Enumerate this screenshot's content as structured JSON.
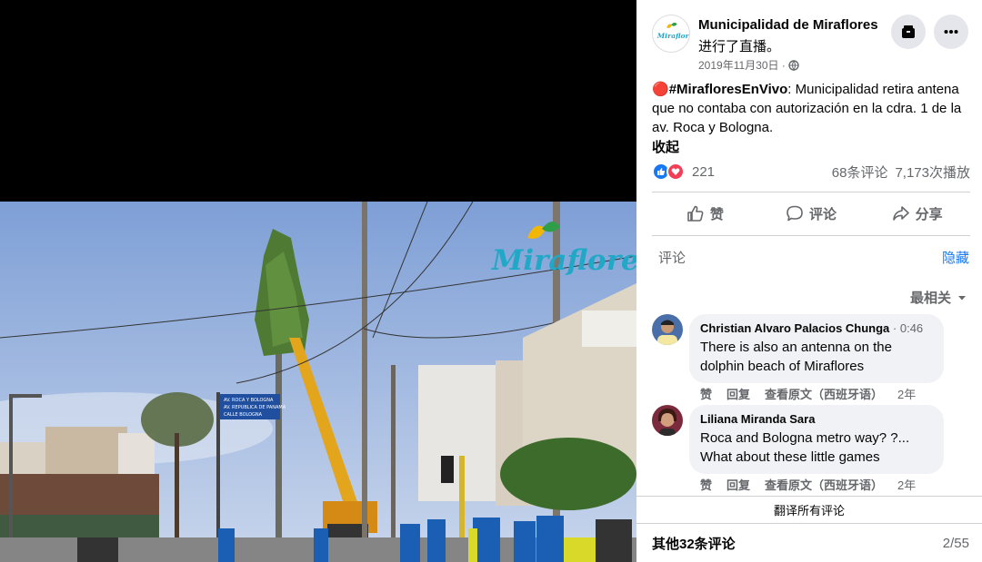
{
  "video": {
    "logo_text": "Miraflores",
    "sign_lines": [
      "AV. ROCA Y BOLOGNA",
      "AV. REPUBLICA DE PANAMA",
      "CALLE BOLOGNA"
    ]
  },
  "post": {
    "page_name": "Municipalidad de Miraflores",
    "avatar_text": "Miraflores",
    "status": "进行了直播。",
    "date": "2019年11月30日 ·",
    "live_dot": "🔴",
    "hashtag": "#MirafloresEnVivo",
    "text": ": Municipalidad retira antena que no contaba con autorización en la cdra. 1 de la av. Roca y Bologna.",
    "collapse_label": "收起",
    "reaction_count": "221",
    "comment_count": "68条评论",
    "view_count": "7,173次播放"
  },
  "actions": {
    "like": "赞",
    "comment": "评论",
    "share": "分享"
  },
  "comments_section": {
    "header": "评论",
    "hide_label": "隐藏",
    "sort_label": "最相关",
    "translate_all": "翻译所有评论",
    "more_comments": "其他32条评论",
    "page_count": "2/55"
  },
  "comments": [
    {
      "author": "Christian Alvaro Palacios Chunga",
      "time": "· 0:46",
      "text": "There is also an antenna on the dolphin beach of Miraflores",
      "like": "赞",
      "reply": "回复",
      "translate": "查看原文（西班牙语）",
      "age": "2年"
    },
    {
      "author": "Liliana Miranda Sara",
      "time": "",
      "text": "Roca and Bologna metro way? ?... What about these little games",
      "like": "赞",
      "reply": "回复",
      "translate": "查看原文（西班牙语）",
      "age": "2年"
    }
  ],
  "colors": {
    "accent": "#1877f2",
    "secondary_text": "#65676b",
    "bubble": "#f0f2f5",
    "love": "#f33e58"
  },
  "icons": [
    "save-icon",
    "more-icon",
    "globe-icon",
    "like-icon",
    "comment-icon",
    "share-icon",
    "chevron-down-icon"
  ]
}
